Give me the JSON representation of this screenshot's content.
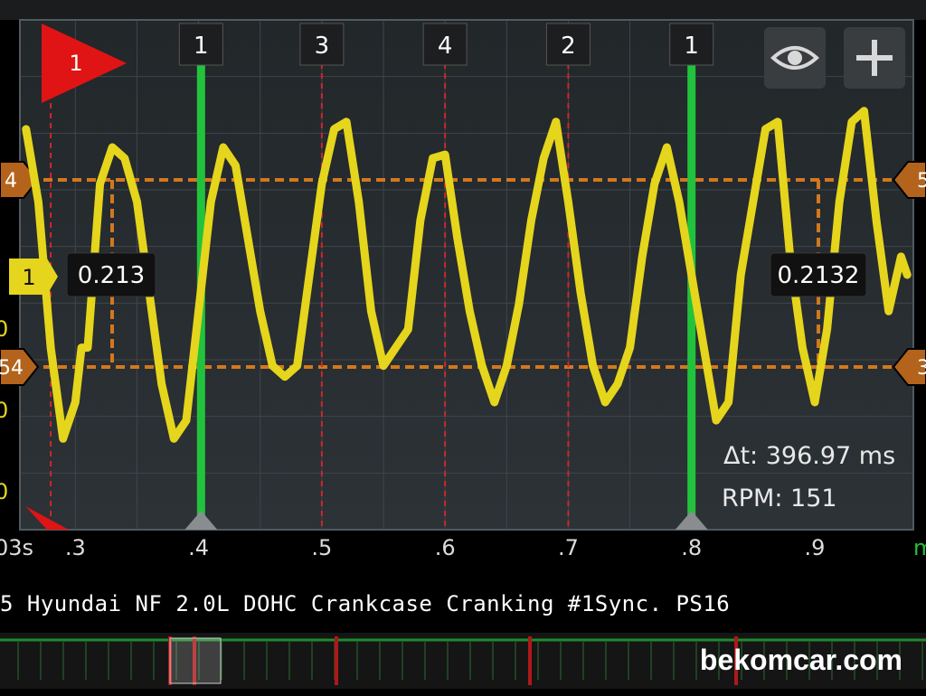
{
  "chart_data": {
    "type": "line",
    "title": "",
    "xlabel": "",
    "ylabel": "",
    "xlim": [
      0.255,
      0.98
    ],
    "ylim": [
      -0.4,
      1.0
    ],
    "x_ticks": [
      ".3",
      ".4",
      ".5",
      ".6",
      ".7",
      ".8",
      ".9"
    ],
    "x_tick_values": [
      0.3,
      0.4,
      0.5,
      0.6,
      0.7,
      0.8,
      0.9
    ],
    "x_left_label": "03s",
    "x_right_label": "m",
    "grid": true,
    "series": [
      {
        "color": "#e5d51c",
        "x": [
          0.26,
          0.27,
          0.28,
          0.29,
          0.3,
          0.305,
          0.31,
          0.32,
          0.33,
          0.34,
          0.35,
          0.36,
          0.37,
          0.38,
          0.39,
          0.4,
          0.41,
          0.42,
          0.43,
          0.44,
          0.45,
          0.46,
          0.47,
          0.48,
          0.49,
          0.5,
          0.51,
          0.52,
          0.53,
          0.54,
          0.55,
          0.56,
          0.57,
          0.58,
          0.59,
          0.6,
          0.61,
          0.62,
          0.63,
          0.64,
          0.65,
          0.66,
          0.67,
          0.68,
          0.69,
          0.7,
          0.71,
          0.72,
          0.73,
          0.74,
          0.75,
          0.76,
          0.77,
          0.78,
          0.79,
          0.8,
          0.81,
          0.82,
          0.83,
          0.84,
          0.85,
          0.86,
          0.87,
          0.88,
          0.89,
          0.9,
          0.91,
          0.92,
          0.93,
          0.94,
          0.95,
          0.96,
          0.97,
          0.975
        ],
        "y": [
          0.7,
          0.5,
          0.1,
          -0.15,
          -0.05,
          0.1,
          0.1,
          0.55,
          0.65,
          0.62,
          0.5,
          0.25,
          0.0,
          -0.15,
          -0.1,
          0.2,
          0.5,
          0.65,
          0.6,
          0.4,
          0.2,
          0.05,
          0.02,
          0.05,
          0.3,
          0.55,
          0.7,
          0.72,
          0.5,
          0.2,
          0.05,
          0.1,
          0.15,
          0.45,
          0.62,
          0.63,
          0.4,
          0.2,
          0.05,
          -0.05,
          0.05,
          0.22,
          0.45,
          0.62,
          0.72,
          0.5,
          0.25,
          0.05,
          -0.05,
          0.0,
          0.1,
          0.35,
          0.55,
          0.65,
          0.5,
          0.3,
          0.1,
          -0.1,
          -0.05,
          0.3,
          0.5,
          0.7,
          0.72,
          0.35,
          0.1,
          -0.05,
          0.15,
          0.5,
          0.72,
          0.75,
          0.45,
          0.2,
          0.35,
          0.3
        ]
      }
    ],
    "marker_lines": [
      {
        "x": 0.402,
        "label": "1",
        "color": "#22c33c",
        "solid": true
      },
      {
        "x": 0.5,
        "label": "3",
        "color": "#d0262a",
        "solid": false
      },
      {
        "x": 0.6,
        "label": "4",
        "color": "#d0262a",
        "solid": false
      },
      {
        "x": 0.7,
        "label": "2",
        "color": "#d0262a",
        "solid": false
      },
      {
        "x": 0.8,
        "label": "1",
        "color": "#22c33c",
        "solid": true
      },
      {
        "x": 0.28,
        "label": "",
        "color": "#d0262a",
        "solid": false
      }
    ],
    "trigger_flag_label": "1",
    "channel_marker_label": "1",
    "cursor_left_value": "0.213",
    "cursor_right_value": "0.2132",
    "h_cursor_labels": {
      "top_left": "4",
      "top_right": "5",
      "bottom_left": "54",
      "bottom_right": "3"
    },
    "left_axis_fragments": [
      "0",
      "0",
      "0"
    ],
    "delta_t": "Δt: 396.97 ms",
    "rpm": "RPM: 151",
    "caption": "5 Hyundai NF 2.0L DOHC Crankcase Cranking #1Sync. PS16",
    "brand": "bekomcar.com",
    "icons": [
      "eye-icon",
      "plus-icon"
    ]
  }
}
